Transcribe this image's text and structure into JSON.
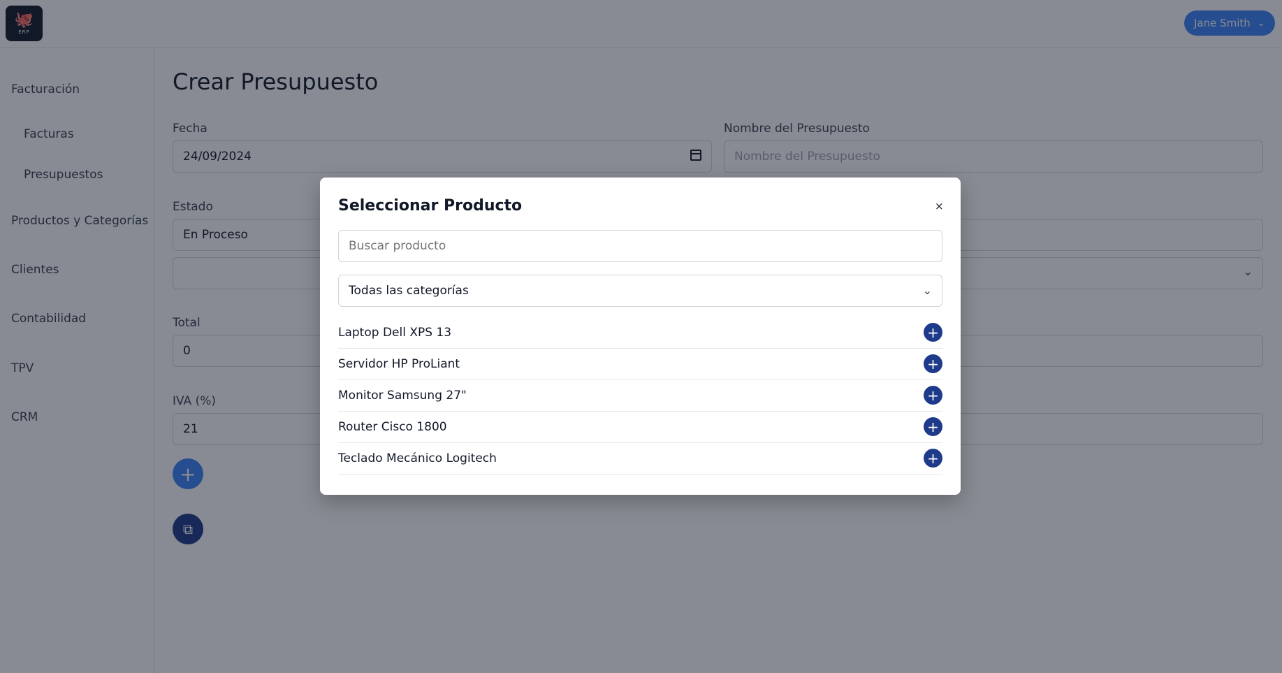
{
  "header": {
    "logo_glyph": "🐙",
    "logo_text": "ERP",
    "user_name": "Jane Smith",
    "user_chevron": "⌄"
  },
  "sidebar": {
    "items": [
      {
        "label": "Facturación"
      },
      {
        "label": "Facturas"
      },
      {
        "label": "Presupuestos"
      },
      {
        "label": "Productos y Categorías"
      },
      {
        "label": "Clientes"
      },
      {
        "label": "Contabilidad"
      },
      {
        "label": "TPV"
      },
      {
        "label": "CRM"
      }
    ]
  },
  "form": {
    "title": "Crear Presupuesto",
    "fecha_label": "Fecha",
    "fecha_value": "24/09/2024",
    "nombre_label": "Nombre del Presupuesto",
    "nombre_placeholder": "Nombre del Presupuesto",
    "estado_label": "Estado",
    "estado_value": "En Proceso",
    "total_label": "Total",
    "total_value": "0",
    "iva_label": "IVA (%)",
    "iva_value": "21",
    "add_icon": "+",
    "save_icon": "⧉",
    "select_chevron": "⌄"
  },
  "modal": {
    "title": "Seleccionar Producto",
    "close": "×",
    "search_placeholder": "Buscar producto",
    "category_value": "Todas las categorías",
    "category_chevron": "⌄",
    "add_icon": "+",
    "products": [
      {
        "name": "Laptop Dell XPS 13"
      },
      {
        "name": "Servidor HP ProLiant"
      },
      {
        "name": "Monitor Samsung 27\""
      },
      {
        "name": "Router Cisco 1800"
      },
      {
        "name": "Teclado Mecánico Logitech"
      }
    ]
  },
  "colors": {
    "primary": "#3b82f6",
    "dark_primary": "#1e3a8a",
    "overlay": "rgba(17,24,39,0.5)"
  }
}
